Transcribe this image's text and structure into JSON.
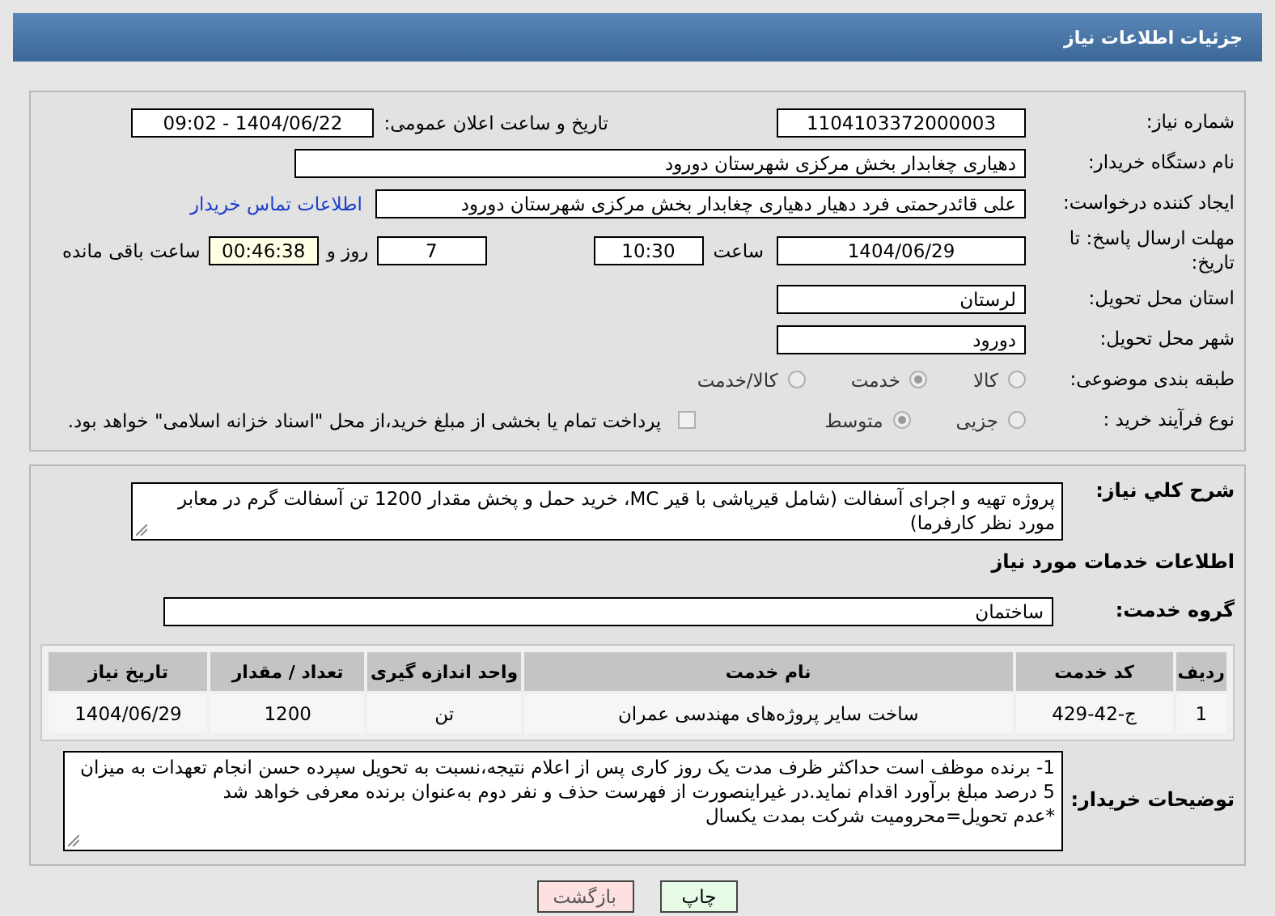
{
  "header": {
    "title": "جزئیات اطلاعات نیاز"
  },
  "details": {
    "need_number": {
      "label": "شماره نیاز:",
      "value": "1104103372000003"
    },
    "announce_datetime": {
      "label": "تاریخ و ساعت اعلان عمومی:",
      "value": "1404/06/22 - 09:02"
    },
    "buyer_org": {
      "label": "نام دستگاه خریدار:",
      "value": "دهیاری چغابدار بخش مرکزی شهرستان دورود"
    },
    "requester": {
      "label": "ایجاد کننده درخواست:",
      "value": "علی قائدرحمتی فرد دهیار دهیاری چغابدار بخش مرکزی شهرستان دورود",
      "contact_link": "اطلاعات تماس خریدار"
    },
    "deadline": {
      "label": "مهلت ارسال پاسخ: تا تاریخ:",
      "date": "1404/06/29",
      "time_label": "ساعت",
      "time": "10:30",
      "days": "7",
      "days_label": "روز و",
      "remaining": "00:46:38",
      "remaining_label": "ساعت باقی مانده"
    },
    "province": {
      "label": "استان محل تحویل:",
      "value": "لرستان"
    },
    "city": {
      "label": "شهر محل تحویل:",
      "value": "دورود"
    },
    "category": {
      "label": "طبقه بندی موضوعی:",
      "options": [
        {
          "label": "کالا",
          "selected": false
        },
        {
          "label": "خدمت",
          "selected": true
        },
        {
          "label": "کالا/خدمت",
          "selected": false
        }
      ]
    },
    "purchase_type": {
      "label": "نوع فرآیند خرید :",
      "options": [
        {
          "label": "جزیی",
          "selected": false
        },
        {
          "label": "متوسط",
          "selected": true
        }
      ],
      "payment_note": {
        "checked": false,
        "text": "پرداخت تمام یا بخشی از مبلغ خرید،از محل \"اسناد خزانه اسلامی\" خواهد بود."
      }
    }
  },
  "needs": {
    "description": {
      "label": "شرح کلي نياز:",
      "value": "پروژه تهیه و اجرای آسفالت (شامل قیرپاشی با قیر MC، خرید حمل و پخش مقدار 1200 تن آسفالت گرم در معابر مورد نظر کارفرما)"
    },
    "section_title": "اطلاعات خدمات مورد نیاز",
    "service_group": {
      "label": "گروه خدمت:",
      "value": "ساختمان"
    },
    "table": {
      "columns": [
        "ردیف",
        "کد خدمت",
        "نام خدمت",
        "واحد اندازه گیری",
        "تعداد / مقدار",
        "تاریخ نیاز"
      ],
      "rows": [
        [
          "1",
          "ج-42-429",
          "ساخت سایر پروژه‌های مهندسی عمران",
          "تن",
          "1200",
          "1404/06/29"
        ]
      ]
    },
    "buyer_notes": {
      "label": "توضیحات خریدار:",
      "value": "1- برنده موظف است حداکثر ظرف مدت یک روز کاری پس از اعلام نتیجه،نسبت به تحویل سپرده حسن انجام تعهدات به میزان 5 درصد مبلغ برآورد اقدام نماید.در غیراینصورت از فهرست حذف و نفر دوم به‌عنوان برنده معرفی خواهد شد\n*عدم تحویل=محرومیت شرکت بمدت یکسال"
    }
  },
  "buttons": [
    {
      "label": "چاپ",
      "kind": "print"
    },
    {
      "label": "بازگشت",
      "kind": "back"
    }
  ]
}
